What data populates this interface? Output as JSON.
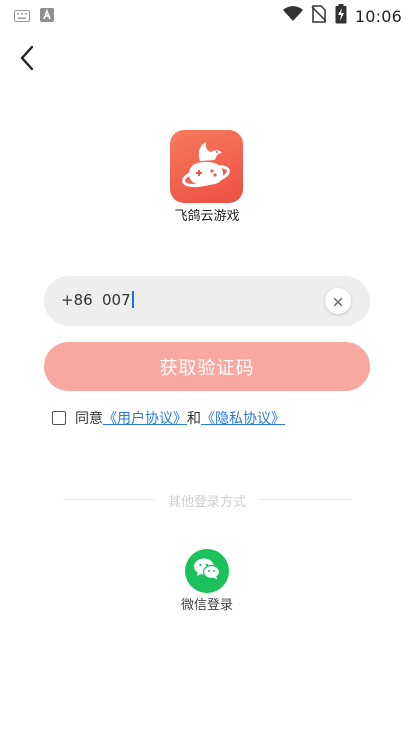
{
  "status_bar": {
    "time": "10:06",
    "icons": [
      "keyboard-icon",
      "a-badge-icon",
      "wifi-icon",
      "no-sim-icon",
      "battery-charging-icon"
    ]
  },
  "nav": {
    "back_icon": "chevron-left-icon"
  },
  "app": {
    "name": "飞鸽云游戏",
    "logo_icon": "pigeon-planet-gamepad-logo"
  },
  "login_form": {
    "country_code": "+86",
    "phone_value": "007",
    "clear_icon": "close-icon",
    "get_code_label": "获取验证码"
  },
  "agreement": {
    "prefix": "同意",
    "user_agreement": "《用户协议》",
    "and": "和",
    "privacy_agreement": "《隐私协议》",
    "checked": false
  },
  "other_login": {
    "label": "其他登录方式",
    "wechat_label": "微信登录",
    "wechat_icon": "wechat-icon"
  },
  "colors": {
    "primary_disabled": "#f8a8a1",
    "logo": "#ec5a48",
    "link": "#2a7ad8",
    "wechat": "#1bc25c"
  }
}
